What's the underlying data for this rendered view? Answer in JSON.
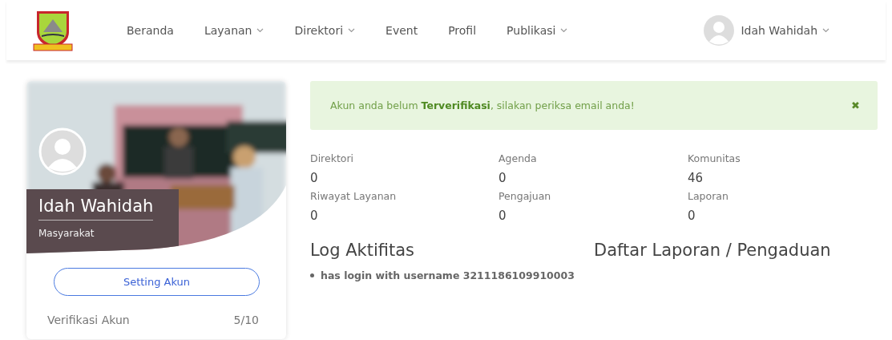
{
  "nav": {
    "items": [
      {
        "label": "Beranda",
        "dropdown": false
      },
      {
        "label": "Layanan",
        "dropdown": true
      },
      {
        "label": "Direktori",
        "dropdown": true
      },
      {
        "label": "Event",
        "dropdown": false
      },
      {
        "label": "Profil",
        "dropdown": false
      },
      {
        "label": "Publikasi",
        "dropdown": true
      }
    ],
    "user": {
      "name": "Idah Wahidah",
      "dropdown": true
    }
  },
  "profile_card": {
    "name": "Idah Wahidah",
    "role": "Masyarakat",
    "button": "Setting Akun",
    "verification": {
      "label": "Verifikasi Akun",
      "value": "5/10"
    }
  },
  "alert": {
    "message": "Akun anda belum **Terverifikasi**, silakan periksa email anda!",
    "close": "✖"
  },
  "stats": [
    {
      "label": "Direktori",
      "value": "0"
    },
    {
      "label": "Agenda",
      "value": "0"
    },
    {
      "label": "Komunitas",
      "value": "46"
    },
    {
      "label": "Riwayat Layanan",
      "value": "0"
    },
    {
      "label": "Pengajuan",
      "value": "0"
    },
    {
      "label": "Laporan",
      "value": "0"
    }
  ],
  "log": {
    "title": "Log Aktifitas",
    "items": [
      "has login with username 3211186109910003"
    ]
  },
  "reports": {
    "title": "Daftar Laporan / Pengaduan"
  }
}
